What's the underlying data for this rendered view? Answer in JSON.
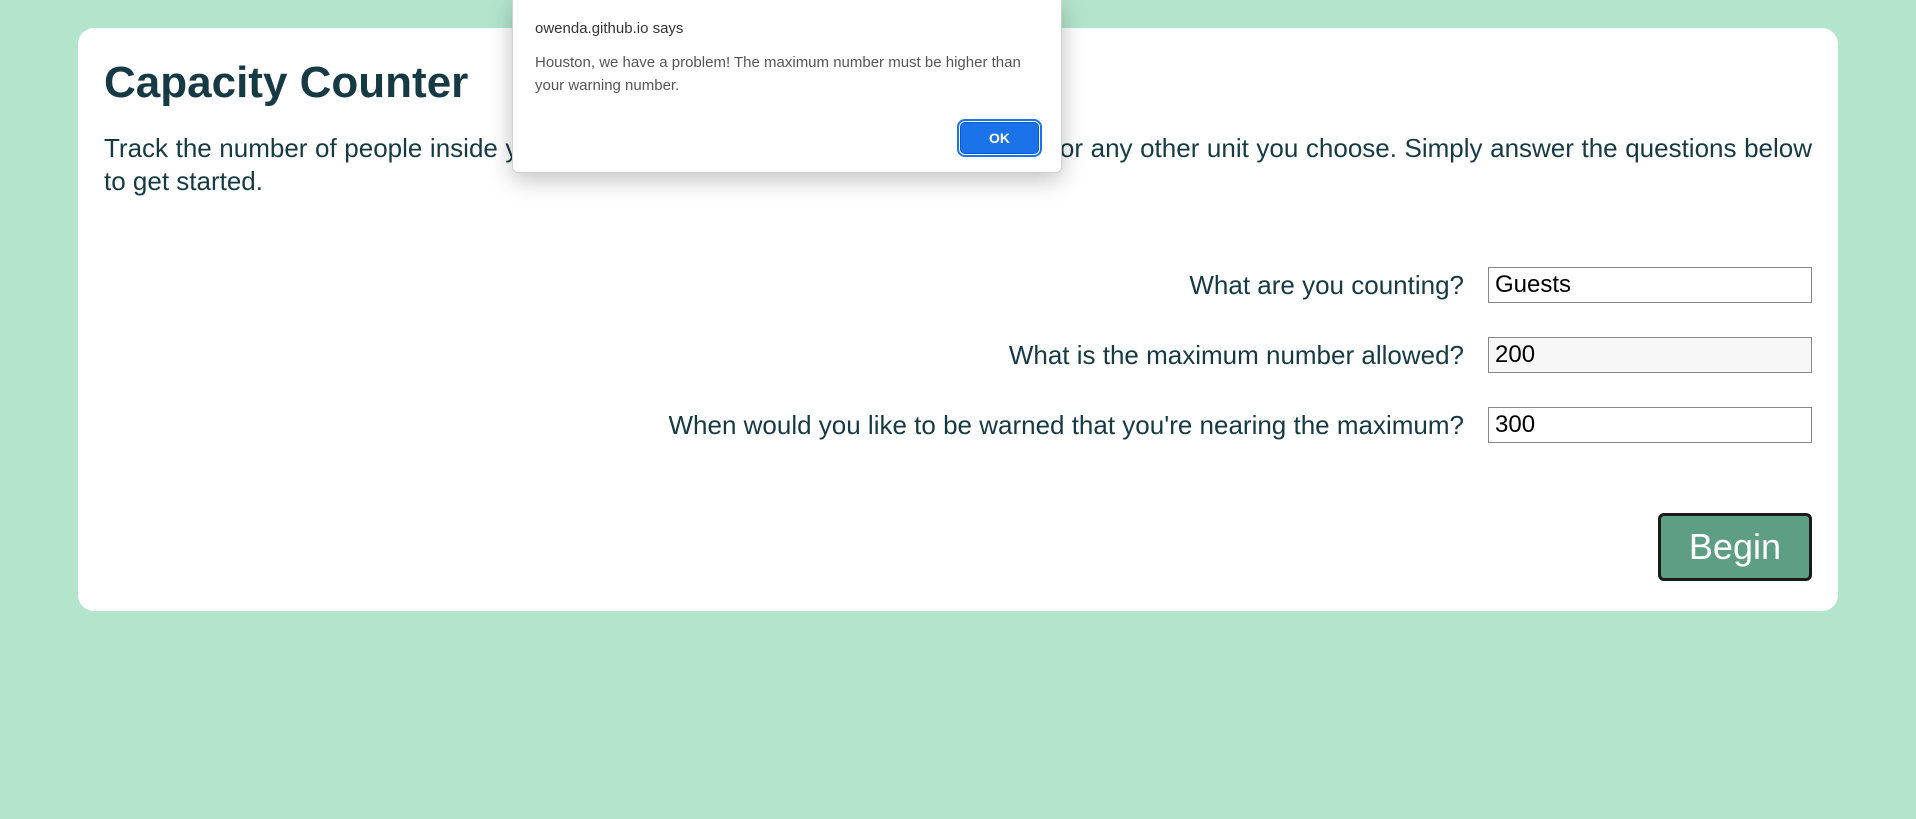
{
  "page": {
    "title": "Capacity Counter",
    "intro": "Track the number of people inside your restaurant, the number of tables occupied, or any other unit you choose. Simply answer the questions below to get started."
  },
  "form": {
    "counting_label": "What are you counting?",
    "counting_value": "Guests",
    "max_label": "What is the maximum number allowed?",
    "max_value": "200",
    "warn_label": "When would you like to be warned that you're nearing the maximum?",
    "warn_value": "300",
    "begin_label": "Begin"
  },
  "alert": {
    "origin": "owenda.github.io says",
    "message": "Houston, we have a problem! The maximum number must be higher than your warning number.",
    "ok_label": "OK"
  }
}
